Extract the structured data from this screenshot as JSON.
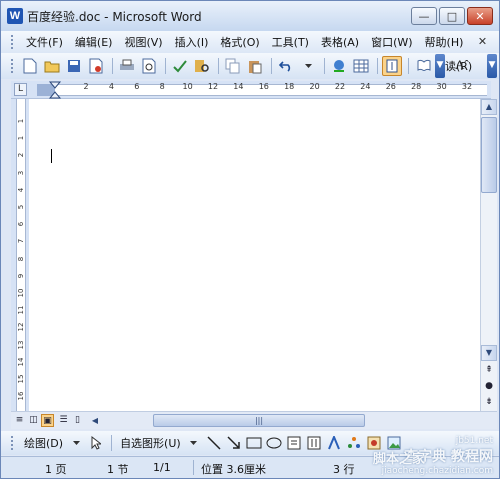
{
  "window": {
    "title": "百度经验.doc - Microsoft Word",
    "app_icon_glyph": "W",
    "min_glyph": "—",
    "max_glyph": "□",
    "close_glyph": "✕"
  },
  "menu": {
    "items": [
      "文件(F)",
      "编辑(E)",
      "视图(V)",
      "插入(I)",
      "格式(O)",
      "工具(T)",
      "表格(A)",
      "窗口(W)",
      "帮助(H)"
    ],
    "close_glyph": "✕"
  },
  "toolbar": {
    "read_label": "阅读(R)",
    "font_grow_label": "Aˆ"
  },
  "ruler": {
    "corner_glyph": "L",
    "numbers": [
      "2",
      "4",
      "6",
      "8",
      "10",
      "12",
      "14",
      "16",
      "18",
      "20",
      "22",
      "24",
      "26",
      "28",
      "30",
      "32"
    ],
    "vertical_numbers": [
      "1",
      "1",
      "2",
      "3",
      "4",
      "5",
      "6",
      "7",
      "8",
      "9",
      "10",
      "11",
      "12",
      "13",
      "14",
      "15",
      "16"
    ]
  },
  "drawing": {
    "draw_label": "绘图(D)",
    "autoshape_label": "自选图形(U)"
  },
  "status": {
    "page": "1 页",
    "section": "1 节",
    "page_of": "1/1",
    "position": "位置 3.6厘米",
    "line": "3 行"
  },
  "watermark": {
    "line1": "脚本之家",
    "line2": "jb51.net",
    "line3": "查字典 教程网",
    "line4": "jiaocheng.chazidian.com"
  }
}
